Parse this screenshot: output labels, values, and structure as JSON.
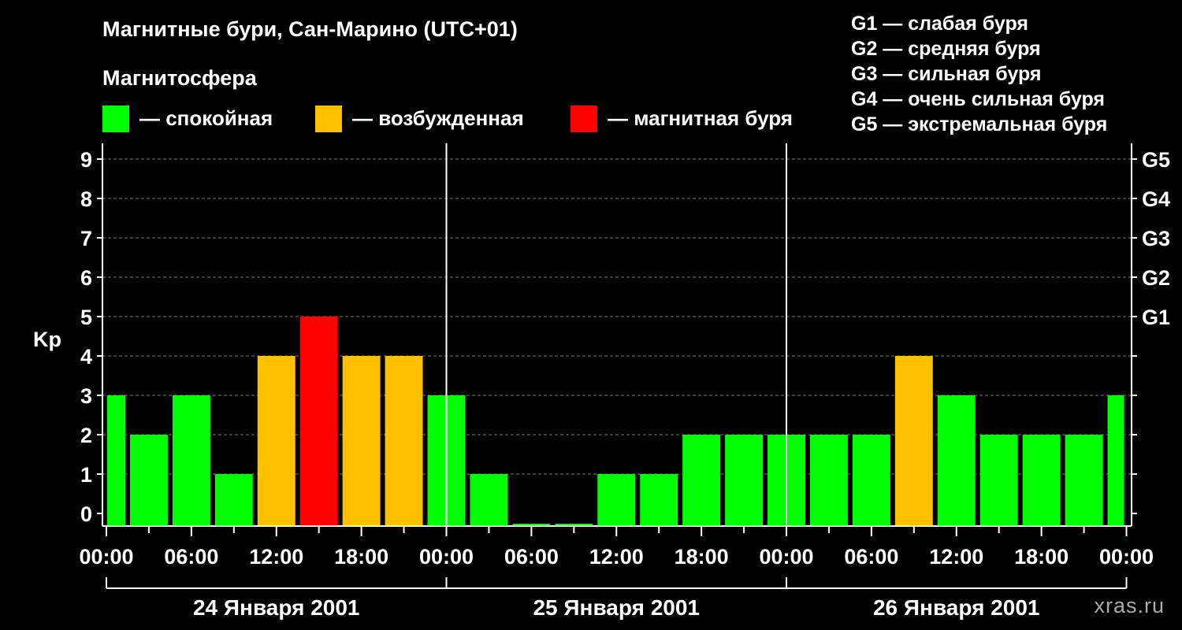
{
  "title": "Магнитные бури, Сан-Марино (UTC+01)",
  "subtitle": "Магнитосфера",
  "legend": [
    {
      "label": "— спокойная",
      "color": "#00ff00"
    },
    {
      "label": "— возбужденная",
      "color": "#ffc000"
    },
    {
      "label": "— магнитная буря",
      "color": "#ff0000"
    }
  ],
  "g_scale": [
    "G1 — слабая буря",
    "G2 — средняя буря",
    "G3 — сильная буря",
    "G4 — очень сильная буря",
    "G5 — экстремальная буря"
  ],
  "watermark": "xras.ru",
  "chart_data": {
    "type": "bar",
    "ylabel": "Kp",
    "ylim": [
      0,
      9
    ],
    "yticks": [
      0,
      1,
      2,
      3,
      4,
      5,
      6,
      7,
      8,
      9
    ],
    "right_ticks": [
      {
        "value": 5,
        "label": "G1"
      },
      {
        "value": 6,
        "label": "G2"
      },
      {
        "value": 7,
        "label": "G3"
      },
      {
        "value": 8,
        "label": "G4"
      },
      {
        "value": 9,
        "label": "G5"
      }
    ],
    "x_tick_labels": [
      "00:00",
      "06:00",
      "12:00",
      "18:00",
      "00:00",
      "06:00",
      "12:00",
      "18:00",
      "00:00",
      "06:00",
      "12:00",
      "18:00",
      "00:00"
    ],
    "days": [
      "24 Января 2001",
      "25 Января 2001",
      "26 Января 2001"
    ],
    "interval_hours": 3,
    "kp_values": [
      3,
      2,
      3,
      1,
      4,
      5,
      4,
      4,
      3,
      1,
      0,
      0,
      1,
      1,
      2,
      2,
      2,
      2,
      2,
      4,
      3,
      2,
      2,
      2,
      3
    ],
    "bar_times": [
      "24 Января 2001 00:00",
      "24 Января 2001 03:00",
      "24 Января 2001 06:00",
      "24 Января 2001 09:00",
      "24 Января 2001 12:00",
      "24 Января 2001 15:00",
      "24 Января 2001 18:00",
      "24 Января 2001 21:00",
      "25 Января 2001 00:00",
      "25 Января 2001 03:00",
      "25 Января 2001 06:00",
      "25 Января 2001 09:00",
      "25 Января 2001 12:00",
      "25 Января 2001 15:00",
      "25 Января 2001 18:00",
      "25 Января 2001 21:00",
      "26 Января 2001 00:00",
      "26 Января 2001 03:00",
      "26 Января 2001 06:00",
      "26 Января 2001 09:00",
      "26 Января 2001 12:00",
      "26 Января 2001 15:00",
      "26 Января 2001 18:00",
      "26 Января 2001 21:00",
      "27 Января 2001 00:00"
    ],
    "colors": {
      "quiet": "#00ff00",
      "active": "#ffc000",
      "storm": "#ff0000"
    },
    "grid": true
  }
}
